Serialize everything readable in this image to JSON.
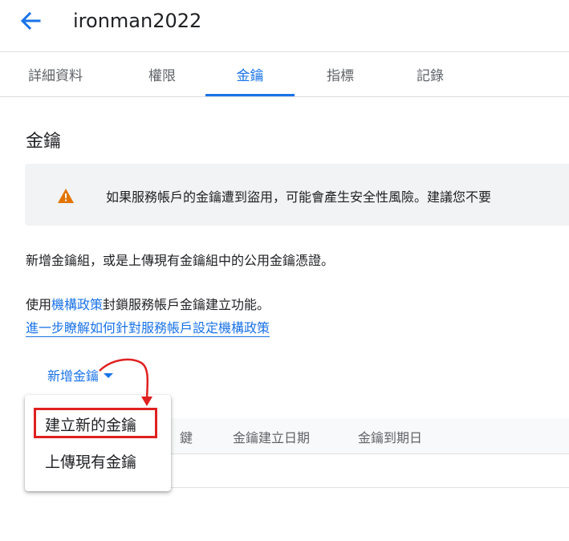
{
  "header": {
    "title": "ironman2022",
    "back_icon": "arrow-left-icon"
  },
  "tabs": [
    {
      "label": "詳細資料",
      "active": false
    },
    {
      "label": "權限",
      "active": false
    },
    {
      "label": "金鑰",
      "active": true
    },
    {
      "label": "指標",
      "active": false
    },
    {
      "label": "記錄",
      "active": false
    }
  ],
  "section": {
    "title": "金鑰"
  },
  "warning": {
    "icon": "warning-icon",
    "text": "如果服務帳戶的金鑰遭到盜用，可能會產生安全性風險。建議您不要"
  },
  "intro": {
    "text": "新增金鑰組，或是上傳現有金鑰組中的公用金鑰憑證。"
  },
  "policy": {
    "prefix": "使用",
    "link": "機構政策",
    "suffix": "封鎖服務帳戶金鑰建立功能。",
    "learn_more": "進一步瞭解如何針對服務帳戶設定機構政策"
  },
  "add_button": {
    "label": "新增金鑰"
  },
  "dropdown": {
    "items": [
      {
        "label": "建立新的金鑰"
      },
      {
        "label": "上傳現有金鑰"
      }
    ]
  },
  "table": {
    "columns": [
      "鍵",
      "金鑰建立日期",
      "金鑰到期日"
    ]
  },
  "colors": {
    "accent": "#1a73e8",
    "warning": "#e37400",
    "annotation": "#e02020"
  }
}
